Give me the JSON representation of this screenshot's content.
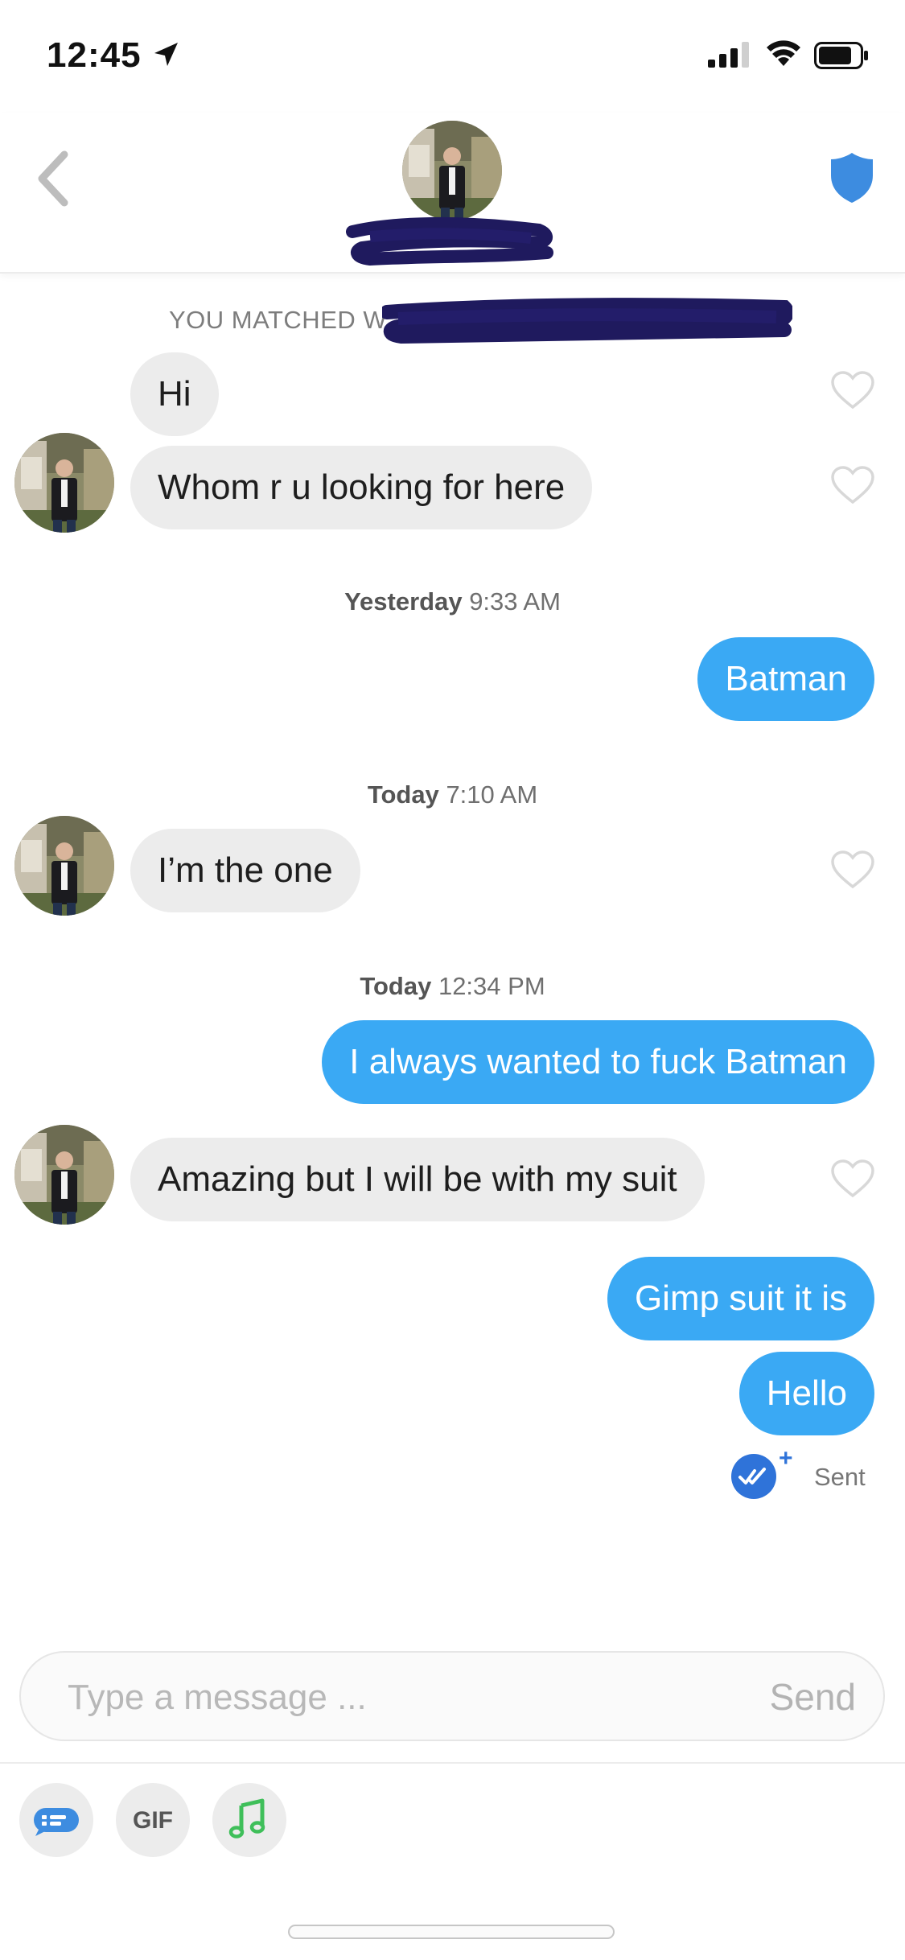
{
  "status_bar": {
    "time": "12:45"
  },
  "header": {
    "shield_color": "#3d8ce0"
  },
  "chat": {
    "matched_text": "YOU MATCHED W",
    "messages": [
      {
        "side": "in",
        "text": "Hi"
      },
      {
        "side": "in",
        "text": "Whom r u looking for here"
      },
      {
        "side": "out",
        "text": "Batman"
      },
      {
        "side": "in",
        "text": "I’m the one"
      },
      {
        "side": "out",
        "text": "I always wanted to fuck Batman"
      },
      {
        "side": "in",
        "text": "Amazing but I will be with my suit"
      },
      {
        "side": "out",
        "text": "Gimp suit it is"
      },
      {
        "side": "out",
        "text": "Hello"
      }
    ],
    "timestamps": [
      {
        "day": "Yesterday",
        "time": "9:33 AM"
      },
      {
        "day": "Today",
        "time": "7:10 AM"
      },
      {
        "day": "Today",
        "time": "12:34 PM"
      }
    ],
    "sent_status": {
      "plus": "+",
      "label": "Sent"
    }
  },
  "composer": {
    "placeholder": "Type a message ...",
    "send_label": "Send"
  },
  "toolbar": {
    "gif_label": "GIF"
  },
  "colors": {
    "outgoing_bubble": "#3aa9f4",
    "incoming_bubble": "#ececec",
    "accent_blue": "#2f73d9",
    "music_green": "#3fbf5a"
  }
}
